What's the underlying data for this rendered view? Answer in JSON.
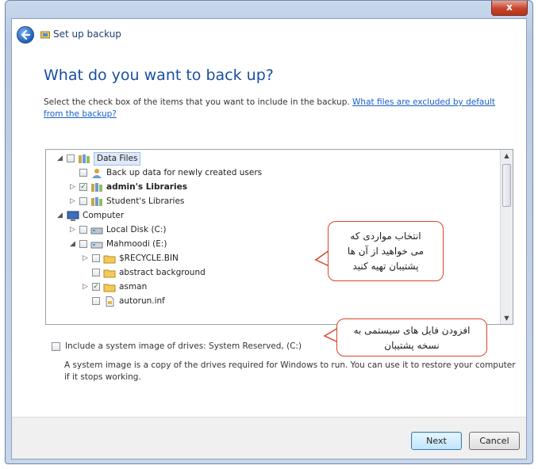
{
  "window": {
    "close_label": "x"
  },
  "nav": {
    "title": "Set up backup"
  },
  "heading": "What do you want to back up?",
  "instructions": {
    "text": "Select the check box of the items that you want to include in the backup.",
    "link": "What files are excluded by default from the backup?"
  },
  "tree": {
    "items": [
      {
        "label": "Data Files",
        "expander": "◢",
        "checked": false
      },
      {
        "label": "Back up data for newly created users",
        "expander": "",
        "checked": false
      },
      {
        "label": "admin's Libraries",
        "expander": "▷",
        "checked": true
      },
      {
        "label": "Student's Libraries",
        "expander": "▷",
        "checked": false
      },
      {
        "label": "Computer",
        "expander": "◢",
        "checked": false
      },
      {
        "label": "Local Disk (C:)",
        "expander": "▷",
        "checked": false
      },
      {
        "label": "Mahmoodi (E:)",
        "expander": "◢",
        "checked": false
      },
      {
        "label": "$RECYCLE.BIN",
        "expander": "▷",
        "checked": false
      },
      {
        "label": "abstract background",
        "expander": "",
        "checked": false
      },
      {
        "label": "asman",
        "expander": "▷",
        "checked": true
      },
      {
        "label": "autorun.inf",
        "expander": "",
        "checked": false
      }
    ]
  },
  "callouts": {
    "select_items": [
      "انتخاب مواردی که",
      "می خواهید از آن ها",
      "پشتیبان تهیه کنید"
    ],
    "system_files": [
      "افزودن فایل های سیستمی به",
      "نسخه پشتیبان"
    ]
  },
  "system_image": {
    "label": "Include a system image of drives: System Reserved, (C:)",
    "note": "A system image is a copy of the drives required for Windows to run. You can use it to restore your computer if it stops working."
  },
  "buttons": {
    "next": "Next",
    "cancel": "Cancel"
  },
  "colors": {
    "title_blue": "#1a4fa3",
    "callout_border": "#d9442d",
    "link": "#1a5fc9"
  }
}
